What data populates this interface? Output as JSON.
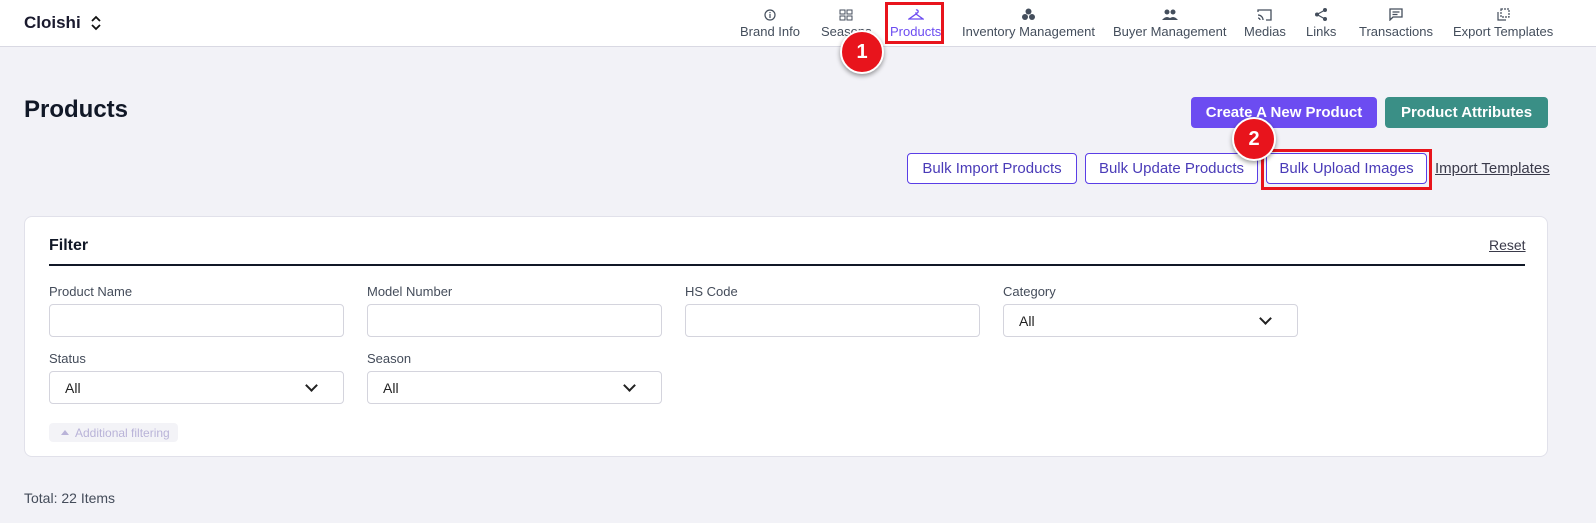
{
  "brand": {
    "name": "Cloishi"
  },
  "nav": [
    {
      "label": "Brand Info",
      "icon": "info-circle-icon"
    },
    {
      "label": "Seasons",
      "icon": "grid-icon"
    },
    {
      "label": "Products",
      "icon": "hanger-icon",
      "active": true
    },
    {
      "label": "Inventory Management",
      "icon": "boxes-icon"
    },
    {
      "label": "Buyer Management",
      "icon": "people-icon"
    },
    {
      "label": "Medias",
      "icon": "cast-icon"
    },
    {
      "label": "Links",
      "icon": "share-icon"
    },
    {
      "label": "Transactions",
      "icon": "message-icon"
    },
    {
      "label": "Export Templates",
      "icon": "copy-icon"
    }
  ],
  "annotations": {
    "step1": "1",
    "step2": "2"
  },
  "page": {
    "title": "Products",
    "create_button": "Create A New Product",
    "attributes_button": "Product Attributes",
    "bulk_import": "Bulk Import Products",
    "bulk_update": "Bulk Update Products",
    "bulk_upload_images": "Bulk Upload Images",
    "import_templates": "Import Templates"
  },
  "filter": {
    "title": "Filter",
    "reset": "Reset",
    "product_name_label": "Product Name",
    "model_number_label": "Model Number",
    "hs_code_label": "HS Code",
    "category_label": "Category",
    "category_value": "All",
    "status_label": "Status",
    "status_value": "All",
    "season_label": "Season",
    "season_value": "All",
    "additional": "Additional filtering"
  },
  "summary": {
    "total": "Total:  22 Items"
  },
  "colors": {
    "accent": "#6c4cf1",
    "teal": "#3a8f86",
    "highlight": "#e8141c"
  }
}
